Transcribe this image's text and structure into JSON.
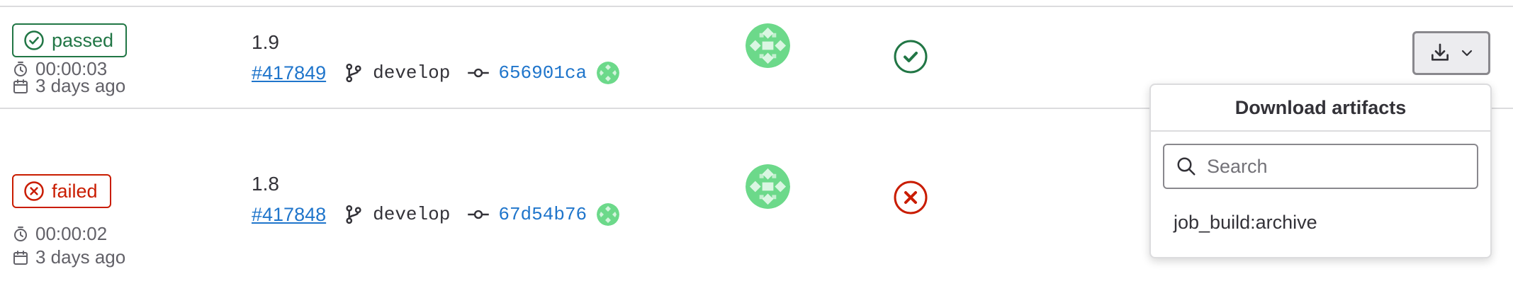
{
  "colors": {
    "passed": "#217645",
    "failed": "#c91c00",
    "link": "#1f75cb",
    "divider": "#dcdcde",
    "avatar_green": "#6cd98a"
  },
  "jobs": [
    {
      "status": "passed",
      "status_label": "passed",
      "status_icon": "check-circle-icon",
      "duration": "00:00:03",
      "finished": "3 days ago",
      "version": "1.9",
      "job_id": "#417849",
      "branch": "develop",
      "commit": "656901ca",
      "stage_icon": "check-circle-icon"
    },
    {
      "status": "failed",
      "status_label": "failed",
      "status_icon": "close-circle-icon",
      "duration": "00:00:02",
      "finished": "3 days ago",
      "version": "1.8",
      "job_id": "#417848",
      "branch": "develop",
      "commit": "67d54b76",
      "stage_icon": "close-circle-icon"
    }
  ],
  "download_menu": {
    "title": "Download artifacts",
    "search_placeholder": "Search",
    "search_value": "",
    "items": [
      {
        "label": "job_build:archive"
      }
    ]
  }
}
